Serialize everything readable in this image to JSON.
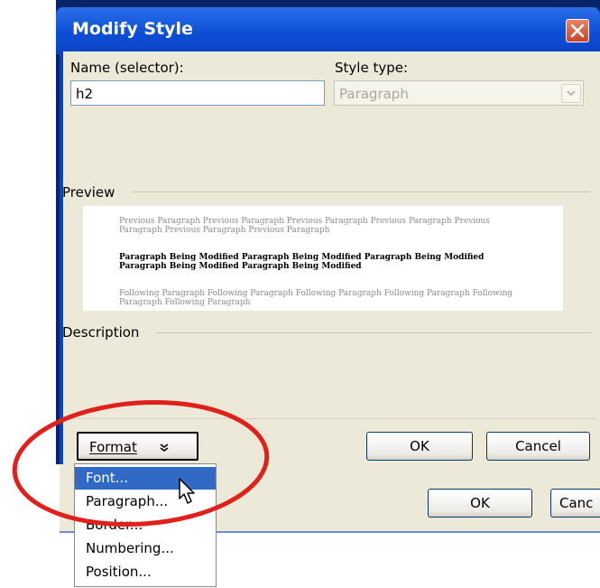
{
  "dialog": {
    "title": "Modify Style",
    "name_label": "Name (selector):",
    "name_value": "h2",
    "style_type_label": "Style type:",
    "style_type_value": "Paragraph",
    "preview_label": "Preview",
    "description_label": "Description",
    "preview": {
      "previous_text": "Previous Paragraph Previous Paragraph Previous Paragraph Previous Paragraph Previous Paragraph Previous Paragraph Previous Paragraph",
      "modified_text": "Paragraph Being Modified Paragraph Being Modified Paragraph Being Modified Paragraph Being Modified Paragraph Being Modified",
      "following_text": "Following Paragraph Following Paragraph Following Paragraph Following Paragraph Following Paragraph Following Paragraph"
    },
    "format_button": "Format",
    "ok_button": "OK",
    "cancel_button": "Cancel"
  },
  "underlying_dialog": {
    "ok_button": "OK",
    "cancel_button": "Canc"
  },
  "format_menu": {
    "items": [
      "Font...",
      "Paragraph...",
      "Border...",
      "Numbering...",
      "Position..."
    ],
    "selected": "Font..."
  },
  "annotation": {
    "color": "#e0211b"
  },
  "icons": {
    "close": "close-icon",
    "combo_arrow": "chevron-down-icon",
    "format_arrow": "double-chevron-down-icon",
    "cursor": "mouse-pointer-icon"
  }
}
